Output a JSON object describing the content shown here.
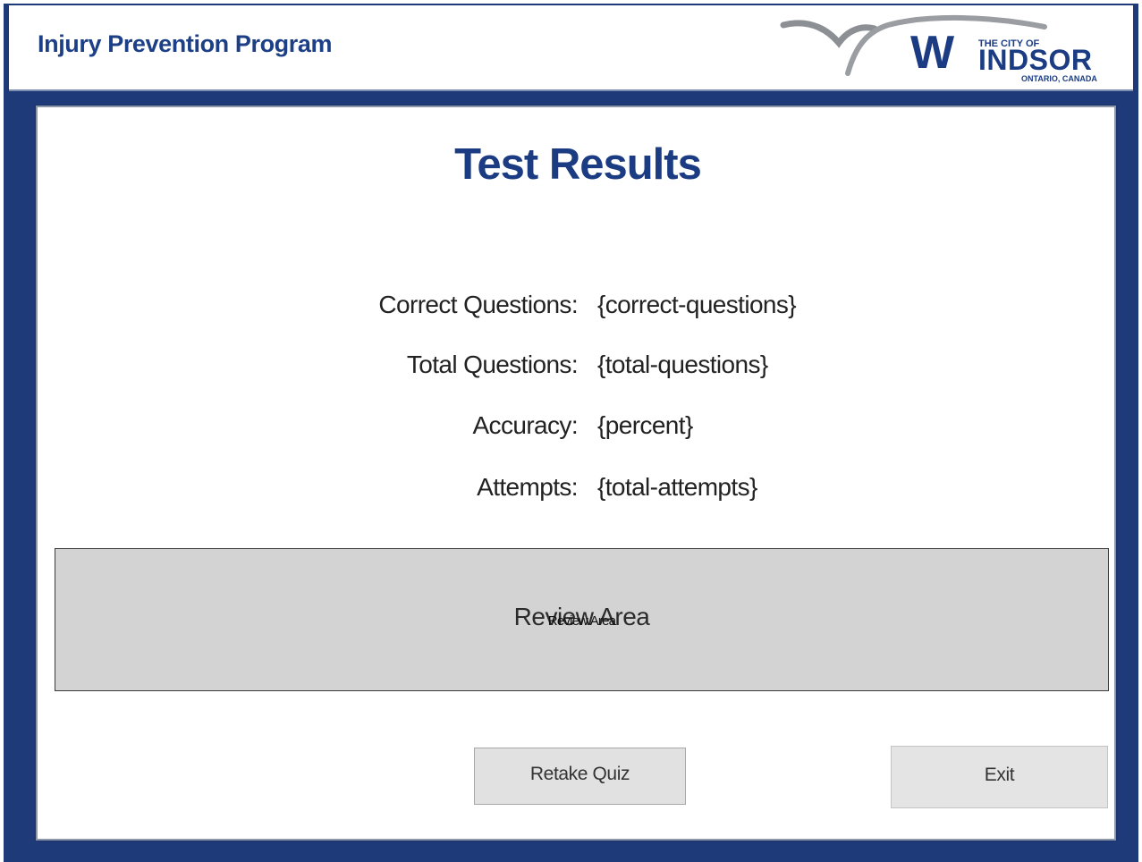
{
  "header": {
    "app_title": "Injury Prevention Program",
    "logo": {
      "line1": "THE CITY OF",
      "line2": "WINDSOR",
      "line3": "ONTARIO, CANADA",
      "icon": "windsor-logo"
    }
  },
  "main": {
    "title": "Test Results",
    "stats": [
      {
        "label": "Correct Questions:",
        "value": "{correct-questions}"
      },
      {
        "label": "Total Questions:",
        "value": "{total-questions}"
      },
      {
        "label": "Accuracy:",
        "value": "{percent}"
      },
      {
        "label": "Attempts:",
        "value": "{total-attempts}"
      }
    ],
    "review_area": {
      "label": "Review Area",
      "label_small": "Review Area"
    },
    "buttons": {
      "retake_label": "Retake Quiz",
      "exit_label": "Exit"
    }
  },
  "colors": {
    "frame": "#1f3a78",
    "title": "#1b3c83",
    "review_bg": "#d3d3d3",
    "button_bg": "#e1e1e1"
  }
}
